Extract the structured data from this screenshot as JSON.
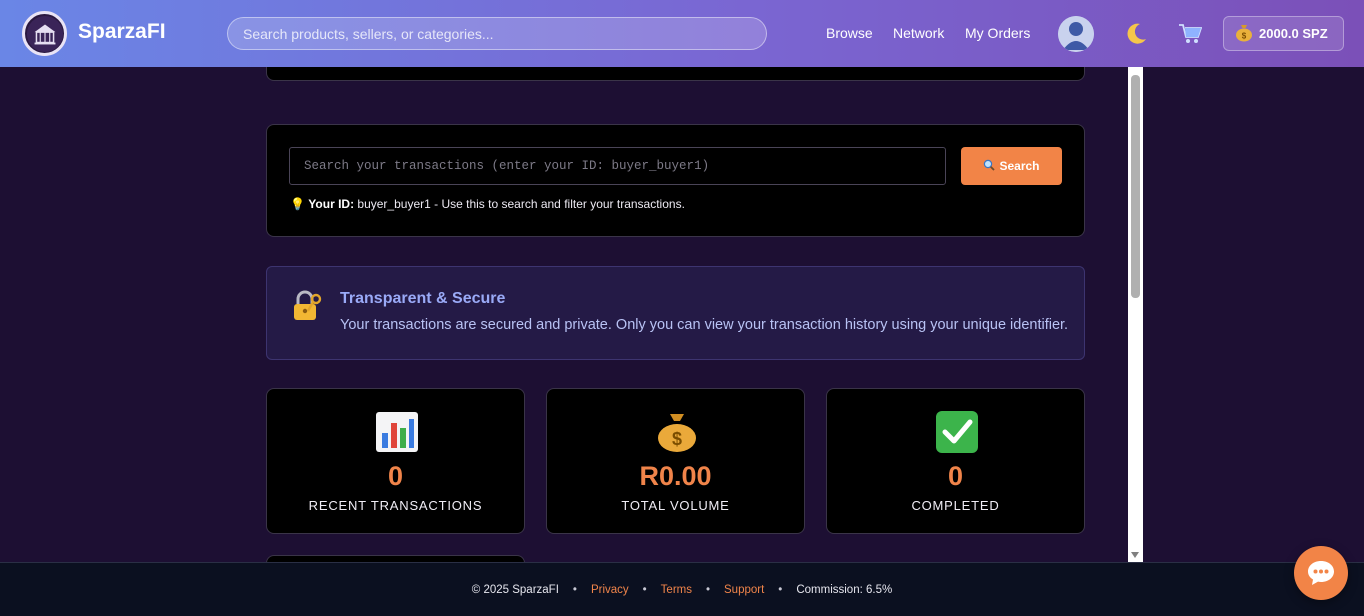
{
  "header": {
    "brand": "SparzaFI",
    "search_placeholder": "Search products, sellers, or categories...",
    "nav": [
      "Browse",
      "Network",
      "My Orders"
    ],
    "balance": "2000.0 SPZ",
    "icons": {
      "logo": "marketplace-logo",
      "user": "user-avatar-icon",
      "theme": "moon-icon",
      "cart": "cart-icon",
      "wallet": "money-bag-icon"
    }
  },
  "transactions_search": {
    "placeholder": "Search your transactions (enter your ID: buyer_buyer1)",
    "button_label": "Search",
    "hint_label": "Your ID:",
    "hint_text": " buyer_buyer1 - Use this to search and filter your transactions."
  },
  "secure": {
    "title": "Transparent & Secure",
    "text": "Your transactions are secured and private. Only you can view your transaction history using your unique identifier."
  },
  "stats": [
    {
      "icon": "bar-chart-icon",
      "value": "0",
      "label": "RECENT TRANSACTIONS"
    },
    {
      "icon": "money-bag-icon",
      "value": "R0.00",
      "label": "TOTAL VOLUME"
    },
    {
      "icon": "check-mark-icon",
      "value": "0",
      "label": "COMPLETED"
    }
  ],
  "footer": {
    "copyright": "© 2025 SparzaFI",
    "links": [
      "Privacy",
      "Terms",
      "Support"
    ],
    "commission": "Commission: 6.5%"
  },
  "colors": {
    "accent": "#f28447",
    "background": "#1d0f33",
    "header_start": "#6a86e6",
    "header_end": "#7b50b8",
    "secure_title": "#9aaaf7"
  }
}
